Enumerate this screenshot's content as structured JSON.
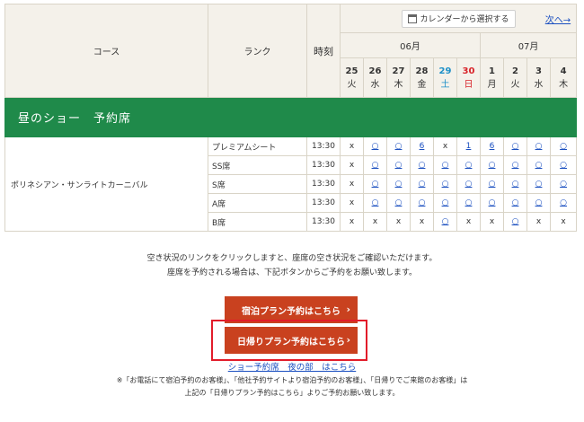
{
  "header": {
    "course": "コース",
    "rank": "ランク",
    "time": "時刻",
    "calendar_button": "カレンダーから選択する",
    "next_link": "次へ→",
    "months": [
      "06月",
      "07月"
    ],
    "days": [
      {
        "date": "25",
        "weekday": "火",
        "type": "weekday"
      },
      {
        "date": "26",
        "weekday": "水",
        "type": "weekday"
      },
      {
        "date": "27",
        "weekday": "木",
        "type": "weekday"
      },
      {
        "date": "28",
        "weekday": "金",
        "type": "weekday"
      },
      {
        "date": "29",
        "weekday": "土",
        "type": "sat"
      },
      {
        "date": "30",
        "weekday": "日",
        "type": "sun"
      },
      {
        "date": "1",
        "weekday": "月",
        "type": "weekday"
      },
      {
        "date": "2",
        "weekday": "火",
        "type": "weekday"
      },
      {
        "date": "3",
        "weekday": "水",
        "type": "weekday"
      },
      {
        "date": "4",
        "weekday": "木",
        "type": "weekday"
      }
    ]
  },
  "section": {
    "title": "昼のショー　予約席"
  },
  "show": {
    "name": "ポリネシアン・サンライトカーニバル"
  },
  "rows": [
    {
      "rank": "プレミアムシート",
      "time": "13:30",
      "cells": [
        "x",
        "○",
        "○",
        "6",
        "x",
        "1",
        "6",
        "○",
        "○",
        "○"
      ]
    },
    {
      "rank": "SS席",
      "time": "13:30",
      "cells": [
        "x",
        "○",
        "○",
        "○",
        "○",
        "○",
        "○",
        "○",
        "○",
        "○"
      ]
    },
    {
      "rank": "S席",
      "time": "13:30",
      "cells": [
        "x",
        "○",
        "○",
        "○",
        "○",
        "○",
        "○",
        "○",
        "○",
        "○"
      ]
    },
    {
      "rank": "A席",
      "time": "13:30",
      "cells": [
        "x",
        "○",
        "○",
        "○",
        "○",
        "○",
        "○",
        "○",
        "○",
        "○"
      ]
    },
    {
      "rank": "B席",
      "time": "13:30",
      "cells": [
        "x",
        "x",
        "x",
        "x",
        "○",
        "x",
        "x",
        "○",
        "x",
        "x"
      ]
    }
  ],
  "info": {
    "line1": "空き状況のリンクをクリックしますと、座席の空き状況をご確認いただけます。",
    "line2": "座席を予約される場合は、下記ボタンからご予約をお願い致します。"
  },
  "buttons": {
    "stay_plan": "宿泊プラン予約はこちら",
    "day_plan": "日帰りプラン予約はこちら",
    "arrow": "›"
  },
  "night_link": "ショー予約席　夜の部　はこちら",
  "note": {
    "line1": "※「お電話にて宿泊予約のお客様」、「他社予約サイトより宿泊予約のお客様」、「日帰りでご来館のお客様」は",
    "line2": "上記の「日帰りプラン予約はこちら」よりご予約お願い致します。"
  },
  "colors": {
    "section_green": "#1f8a4a",
    "button_red": "#c9411f",
    "highlight_red": "#e21c2a",
    "link_blue": "#1a4fc0"
  }
}
